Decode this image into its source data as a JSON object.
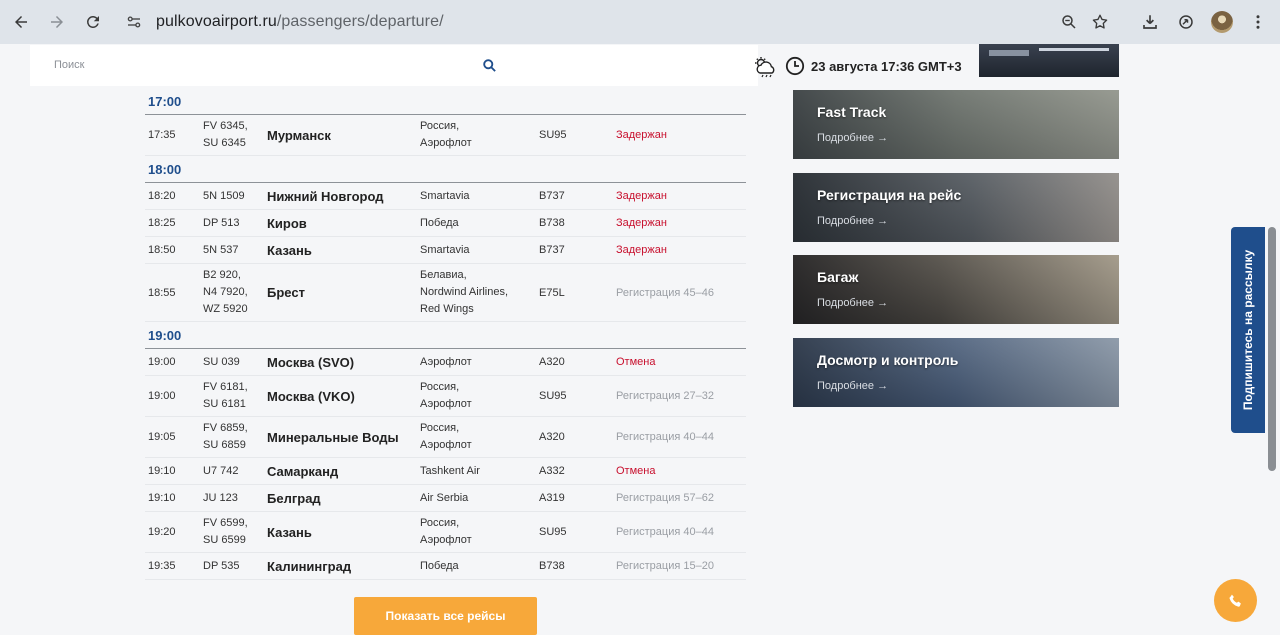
{
  "browser": {
    "url_host": "pulkovoairport.ru",
    "url_path": "/passengers/departure/"
  },
  "search": {
    "placeholder": "Поиск"
  },
  "header": {
    "datetime": "23 августа 17:36 GMT+3"
  },
  "departures": [
    {
      "hour": "17:00",
      "flights": [
        {
          "time": "17:35",
          "flight": [
            "FV 6345,",
            "SU 6345"
          ],
          "city": "Мурманск",
          "airline": [
            "Россия,",
            "Аэрофлот"
          ],
          "plane": "SU95",
          "status": "Задержан",
          "status_type": "red"
        }
      ]
    },
    {
      "hour": "18:00",
      "flights": [
        {
          "time": "18:20",
          "flight": [
            "5N 1509"
          ],
          "city": "Нижний Новгород",
          "airline": [
            "Smartavia"
          ],
          "plane": "B737",
          "status": "Задержан",
          "status_type": "red"
        },
        {
          "time": "18:25",
          "flight": [
            "DP 513"
          ],
          "city": "Киров",
          "airline": [
            "Победа"
          ],
          "plane": "B738",
          "status": "Задержан",
          "status_type": "red"
        },
        {
          "time": "18:50",
          "flight": [
            "5N 537"
          ],
          "city": "Казань",
          "airline": [
            "Smartavia"
          ],
          "plane": "B737",
          "status": "Задержан",
          "status_type": "red"
        },
        {
          "time": "18:55",
          "flight": [
            "B2 920,",
            "N4 7920,",
            "WZ 5920"
          ],
          "city": "Брест",
          "airline": [
            "Белавиа,",
            "Nordwind Airlines,",
            "Red Wings"
          ],
          "plane": "E75L",
          "status": "Регистрация 45–46",
          "status_type": "gray"
        }
      ]
    },
    {
      "hour": "19:00",
      "flights": [
        {
          "time": "19:00",
          "flight": [
            "SU 039"
          ],
          "city": "Москва (SVO)",
          "airline": [
            "Аэрофлот"
          ],
          "plane": "A320",
          "status": "Отмена",
          "status_type": "red"
        },
        {
          "time": "19:00",
          "flight": [
            "FV 6181,",
            "SU 6181"
          ],
          "city": "Москва (VKO)",
          "airline": [
            "Россия,",
            "Аэрофлот"
          ],
          "plane": "SU95",
          "status": "Регистрация 27–32",
          "status_type": "gray"
        },
        {
          "time": "19:05",
          "flight": [
            "FV 6859,",
            "SU 6859"
          ],
          "city": "Минеральные Воды",
          "airline": [
            "Россия,",
            "Аэрофлот"
          ],
          "plane": "A320",
          "status": "Регистрация 40–44",
          "status_type": "gray"
        },
        {
          "time": "19:10",
          "flight": [
            "U7 742"
          ],
          "city": "Самарканд",
          "airline": [
            "Tashkent Air"
          ],
          "plane": "A332",
          "status": "Отмена",
          "status_type": "red"
        },
        {
          "time": "19:10",
          "flight": [
            "JU 123"
          ],
          "city": "Белград",
          "airline": [
            "Air Serbia"
          ],
          "plane": "A319",
          "status": "Регистрация 57–62",
          "status_type": "gray"
        },
        {
          "time": "19:20",
          "flight": [
            "FV 6599,",
            "SU 6599"
          ],
          "city": "Казань",
          "airline": [
            "Россия,",
            "Аэрофлот"
          ],
          "plane": "SU95",
          "status": "Регистрация 40–44",
          "status_type": "gray"
        },
        {
          "time": "19:35",
          "flight": [
            "DP 535"
          ],
          "city": "Калининград",
          "airline": [
            "Победа"
          ],
          "plane": "B738",
          "status": "Регистрация 15–20",
          "status_type": "gray"
        }
      ]
    }
  ],
  "show_all_label": "Показать все рейсы",
  "cards": [
    {
      "title": "Fast Track",
      "more": "Подробнее →"
    },
    {
      "title": "Регистрация на рейс",
      "more": "Подробнее →"
    },
    {
      "title": "Багаж",
      "more": "Подробнее →"
    },
    {
      "title": "Досмотр и контроль",
      "more": "Подробнее →"
    }
  ],
  "subscribe_label": "Подпишитесь на рассылку",
  "colors": {
    "accent_blue": "#1f4e8c",
    "accent_orange": "#f7a83a",
    "status_red": "#c8102e",
    "status_gray": "#9a9ea4"
  },
  "icons": [
    "back-icon",
    "forward-icon",
    "reload-icon",
    "site-info-icon",
    "zoom-icon",
    "star-icon",
    "download-icon",
    "extension-icon",
    "menu-icon",
    "search-icon",
    "weather-icon",
    "clock-icon",
    "phone-icon"
  ]
}
